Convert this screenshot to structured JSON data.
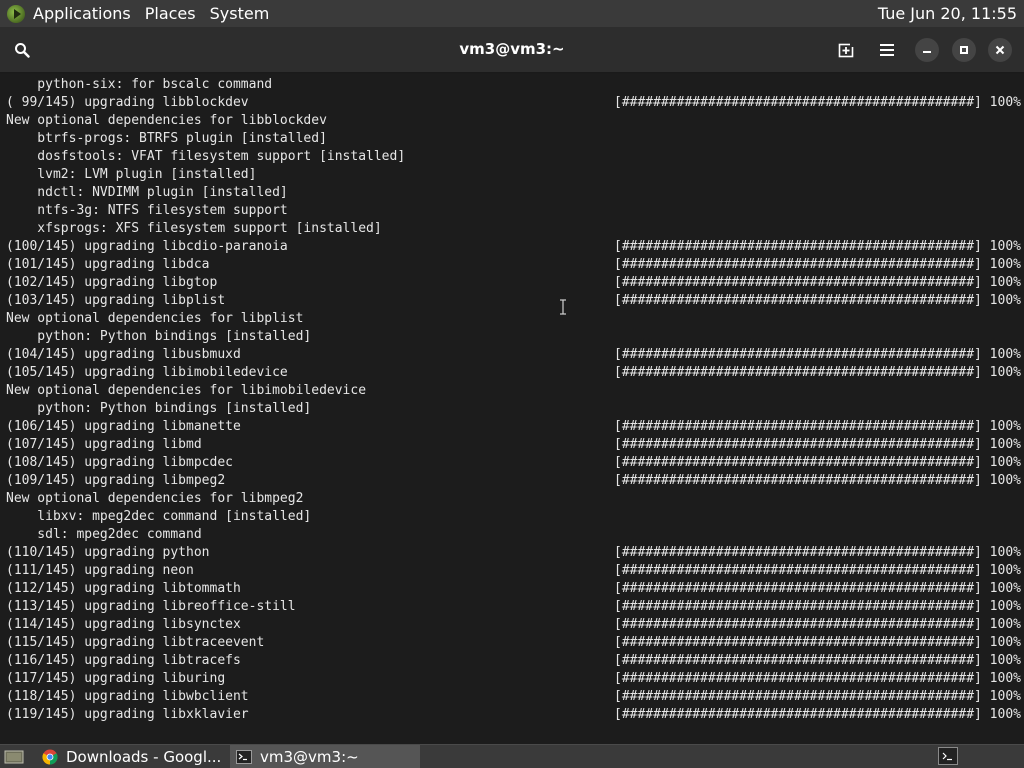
{
  "top_panel": {
    "menus": [
      "Applications",
      "Places",
      "System"
    ],
    "clock": "Tue Jun 20, 11:55"
  },
  "header": {
    "title": "vm3@vm3:~",
    "icons": [
      "search-icon",
      "new-tab-icon",
      "hamburger-menu-icon",
      "minimize-icon",
      "maximize-icon",
      "close-icon"
    ]
  },
  "terminal": {
    "lines": [
      {
        "text": "    python-six: for bscalc command",
        "progress": ""
      },
      {
        "text": "( 99/145) upgrading libblockdev",
        "progress": "[#############################################] 100%"
      },
      {
        "text": "New optional dependencies for libblockdev",
        "progress": ""
      },
      {
        "text": "    btrfs-progs: BTRFS plugin [installed]",
        "progress": ""
      },
      {
        "text": "    dosfstools: VFAT filesystem support [installed]",
        "progress": ""
      },
      {
        "text": "    lvm2: LVM plugin [installed]",
        "progress": ""
      },
      {
        "text": "    ndctl: NVDIMM plugin [installed]",
        "progress": ""
      },
      {
        "text": "    ntfs-3g: NTFS filesystem support",
        "progress": ""
      },
      {
        "text": "    xfsprogs: XFS filesystem support [installed]",
        "progress": ""
      },
      {
        "text": "(100/145) upgrading libcdio-paranoia",
        "progress": "[#############################################] 100%"
      },
      {
        "text": "(101/145) upgrading libdca",
        "progress": "[#############################################] 100%"
      },
      {
        "text": "(102/145) upgrading libgtop",
        "progress": "[#############################################] 100%"
      },
      {
        "text": "(103/145) upgrading libplist",
        "progress": "[#############################################] 100%"
      },
      {
        "text": "New optional dependencies for libplist",
        "progress": ""
      },
      {
        "text": "    python: Python bindings [installed]",
        "progress": ""
      },
      {
        "text": "(104/145) upgrading libusbmuxd",
        "progress": "[#############################################] 100%"
      },
      {
        "text": "(105/145) upgrading libimobiledevice",
        "progress": "[#############################################] 100%"
      },
      {
        "text": "New optional dependencies for libimobiledevice",
        "progress": ""
      },
      {
        "text": "    python: Python bindings [installed]",
        "progress": ""
      },
      {
        "text": "(106/145) upgrading libmanette",
        "progress": "[#############################################] 100%"
      },
      {
        "text": "(107/145) upgrading libmd",
        "progress": "[#############################################] 100%"
      },
      {
        "text": "(108/145) upgrading libmpcdec",
        "progress": "[#############################################] 100%"
      },
      {
        "text": "(109/145) upgrading libmpeg2",
        "progress": "[#############################################] 100%"
      },
      {
        "text": "New optional dependencies for libmpeg2",
        "progress": ""
      },
      {
        "text": "    libxv: mpeg2dec command [installed]",
        "progress": ""
      },
      {
        "text": "    sdl: mpeg2dec command",
        "progress": ""
      },
      {
        "text": "(110/145) upgrading python",
        "progress": "[#############################################] 100%"
      },
      {
        "text": "(111/145) upgrading neon",
        "progress": "[#############################################] 100%"
      },
      {
        "text": "(112/145) upgrading libtommath",
        "progress": "[#############################################] 100%"
      },
      {
        "text": "(113/145) upgrading libreoffice-still",
        "progress": "[#############################################] 100%"
      },
      {
        "text": "(114/145) upgrading libsynctex",
        "progress": "[#############################################] 100%"
      },
      {
        "text": "(115/145) upgrading libtraceevent",
        "progress": "[#############################################] 100%"
      },
      {
        "text": "(116/145) upgrading libtracefs",
        "progress": "[#############################################] 100%"
      },
      {
        "text": "(117/145) upgrading liburing",
        "progress": "[#############################################] 100%"
      },
      {
        "text": "(118/145) upgrading libwbclient",
        "progress": "[#############################################] 100%"
      },
      {
        "text": "(119/145) upgrading libxklavier",
        "progress": "[#############################################] 100%"
      }
    ]
  },
  "taskbar": {
    "items": [
      {
        "label": "Downloads - Googl...",
        "icon": "chrome-icon",
        "active": false
      },
      {
        "label": "vm3@vm3:~",
        "icon": "terminal-icon",
        "active": true
      }
    ]
  },
  "colors": {
    "panel_bg": "#3a3a3a",
    "header_bg": "#2d2d2d",
    "terminal_bg": "#1c1c1c",
    "terminal_fg": "#e6e6e6"
  }
}
